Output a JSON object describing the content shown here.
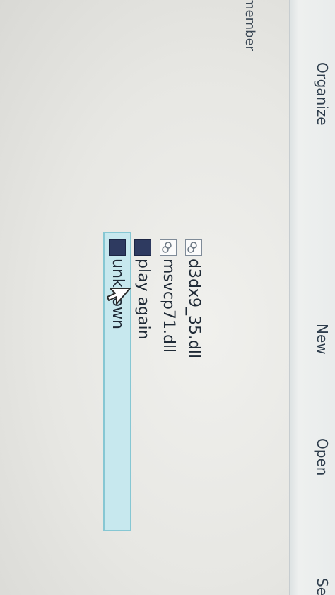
{
  "toolbar": {
    "organize": "Organize",
    "new": "New",
    "open": "Open",
    "share_partial": "Se"
  },
  "sidebar": {
    "item_partial": "member"
  },
  "files": [
    {
      "name": "d3dx9_35.dll",
      "icon": "dll-file-icon",
      "selected": false
    },
    {
      "name": "msvcp71.dll",
      "icon": "dll-file-icon",
      "selected": false
    },
    {
      "name": "play again",
      "icon": "application-icon",
      "selected": false
    },
    {
      "name": "unknown",
      "icon": "application-icon",
      "selected": true
    }
  ],
  "colors": {
    "selection_fill": "#c7e8ee",
    "selection_border": "#86c7d3",
    "app_icon": "#2e3a60"
  }
}
